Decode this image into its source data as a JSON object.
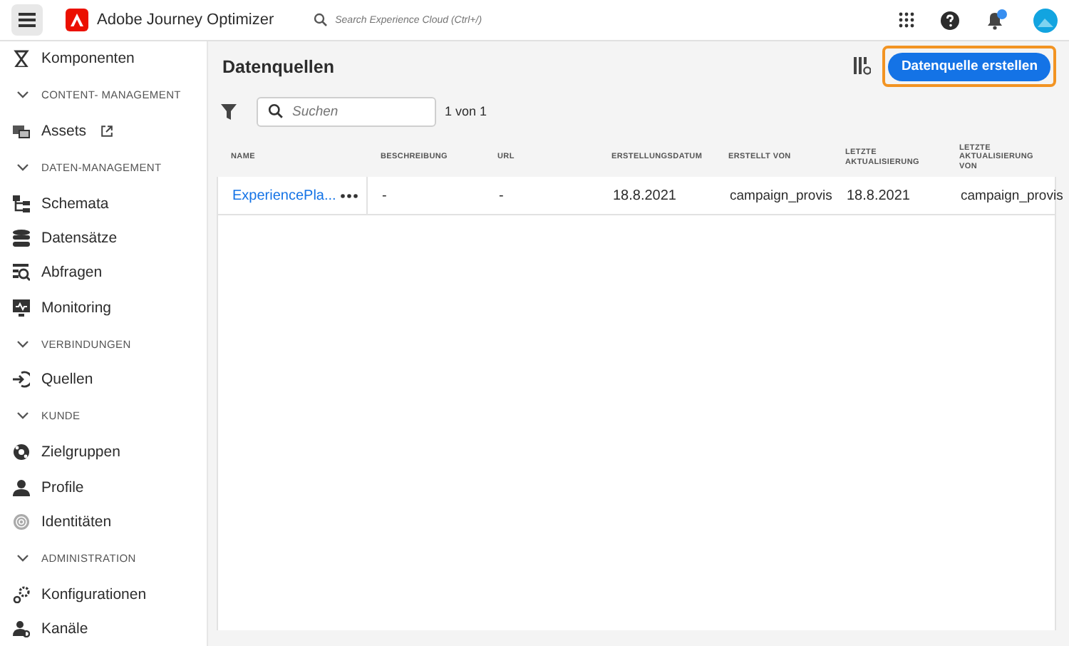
{
  "app": {
    "title": "Adobe Journey Optimizer"
  },
  "search": {
    "placeholder": "Search Experience Cloud (Ctrl+/)"
  },
  "sidebar": {
    "items": [
      {
        "kind": "item",
        "label": "Komponenten"
      },
      {
        "kind": "section",
        "label": "CONTENT- MANAGEMENT",
        "expanded": true
      },
      {
        "kind": "item",
        "label": "Assets",
        "external": true
      },
      {
        "kind": "section",
        "label": "DATEN-MANAGEMENT",
        "expanded": true
      },
      {
        "kind": "item",
        "label": "Schemata"
      },
      {
        "kind": "item",
        "label": "Datensätze"
      },
      {
        "kind": "item",
        "label": "Abfragen"
      },
      {
        "kind": "item",
        "label": "Monitoring"
      },
      {
        "kind": "section",
        "label": "VERBINDUNGEN",
        "expanded": true
      },
      {
        "kind": "item",
        "label": "Quellen"
      },
      {
        "kind": "section",
        "label": "KUNDE",
        "expanded": true
      },
      {
        "kind": "item",
        "label": "Zielgruppen"
      },
      {
        "kind": "item",
        "label": "Profile"
      },
      {
        "kind": "item",
        "label": "Identitäten"
      },
      {
        "kind": "section",
        "label": "ADMINISTRATION",
        "expanded": true
      },
      {
        "kind": "item",
        "label": "Konfigurationen"
      },
      {
        "kind": "item",
        "label": "Kanäle"
      }
    ]
  },
  "page": {
    "title": "Datenquellen",
    "create_button": "Datenquelle erstellen",
    "filter_placeholder": "Suchen",
    "count": "1 von 1"
  },
  "table": {
    "columns": [
      "NAME",
      "BESCHREIBUNG",
      "URL",
      "ERSTELLUNGSDATUM",
      "ERSTELLT VON",
      "LETZTE AKTUALISIERUNG",
      "LETZTE AKTUALISIERUNG VON"
    ],
    "rows": [
      {
        "cells": [
          "ExperiencePla...",
          "-",
          "-",
          "18.8.2021",
          "campaign_provis",
          "18.8.2021",
          "campaign_provis"
        ]
      }
    ]
  }
}
